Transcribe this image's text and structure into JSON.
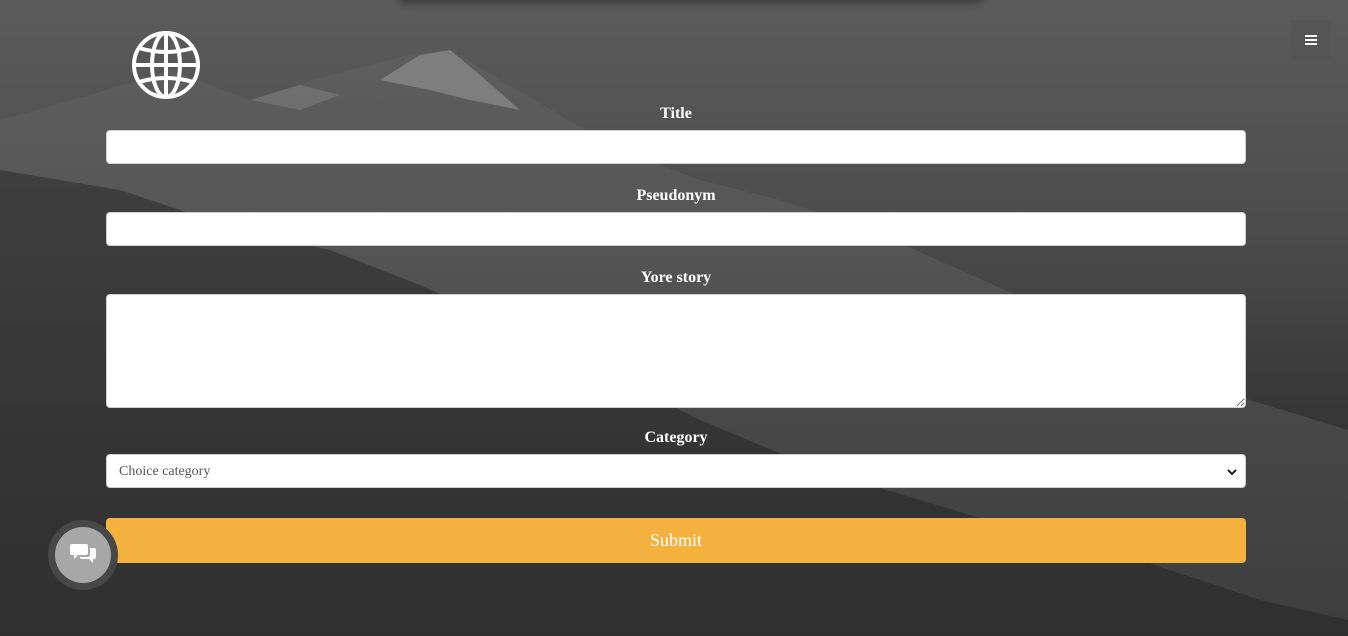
{
  "header": {
    "logo_icon": "globe-icon",
    "menu_icon": "hamburger-menu-icon"
  },
  "form": {
    "title_label": "Title",
    "title_value": "",
    "pseudonym_label": "Pseudonym",
    "pseudonym_value": "",
    "story_label": "Yore story",
    "story_value": "",
    "category_label": "Category",
    "category_selected": "Choice category",
    "submit_label": "Submit"
  },
  "chat": {
    "icon": "chat-bubbles-icon"
  },
  "colors": {
    "submit": "#f5b13e",
    "menu_button": "#555555",
    "label_text": "#ffffff"
  }
}
